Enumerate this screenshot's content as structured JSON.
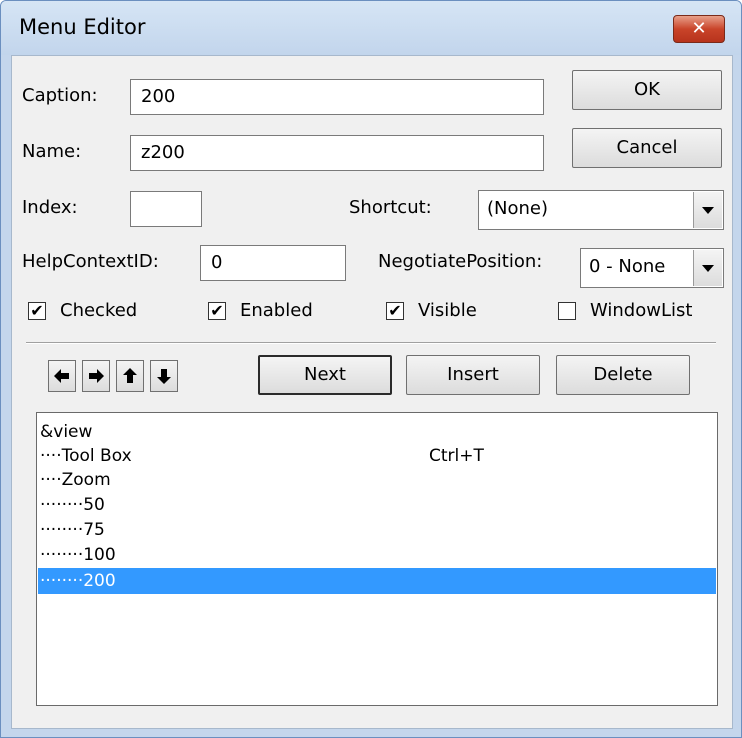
{
  "window": {
    "title": "Menu Editor",
    "close_glyph": "✕"
  },
  "fields": {
    "caption_label": "Caption:",
    "caption_value": "200",
    "name_label": "Name:",
    "name_value": "z200",
    "index_label": "Index:",
    "index_value": "",
    "shortcut_label": "Shortcut:",
    "shortcut_value": "(None)",
    "helpcontext_label": "HelpContextID:",
    "helpcontext_value": "0",
    "negotiate_label": "NegotiatePosition:",
    "negotiate_value": "0 - None"
  },
  "buttons": {
    "ok": "OK",
    "cancel": "Cancel",
    "next": "Next",
    "insert": "Insert",
    "delete": "Delete"
  },
  "checkboxes": {
    "checked": {
      "label": "Checked",
      "state": true
    },
    "enabled": {
      "label": "Enabled",
      "state": true
    },
    "visible": {
      "label": "Visible",
      "state": true
    },
    "windowlist": {
      "label": "WindowList",
      "state": false
    }
  },
  "check_glyph": "✔",
  "arrows": {
    "left": "left-arrow-icon",
    "right": "right-arrow-icon",
    "up": "up-arrow-icon",
    "down": "down-arrow-icon"
  },
  "menu_items": [
    {
      "caption": "&view",
      "shortcut": ""
    },
    {
      "caption": "····Tool Box",
      "shortcut": "Ctrl+T"
    },
    {
      "caption": "····Zoom",
      "shortcut": ""
    },
    {
      "caption": "········50",
      "shortcut": ""
    },
    {
      "caption": "········75",
      "shortcut": ""
    },
    {
      "caption": "········100",
      "shortcut": ""
    },
    {
      "caption": "········200",
      "shortcut": ""
    }
  ],
  "selected_index": 6,
  "colors": {
    "selection": "#3399ff",
    "close_button": "#c9442a",
    "titlebar": "#c4d6ec"
  }
}
